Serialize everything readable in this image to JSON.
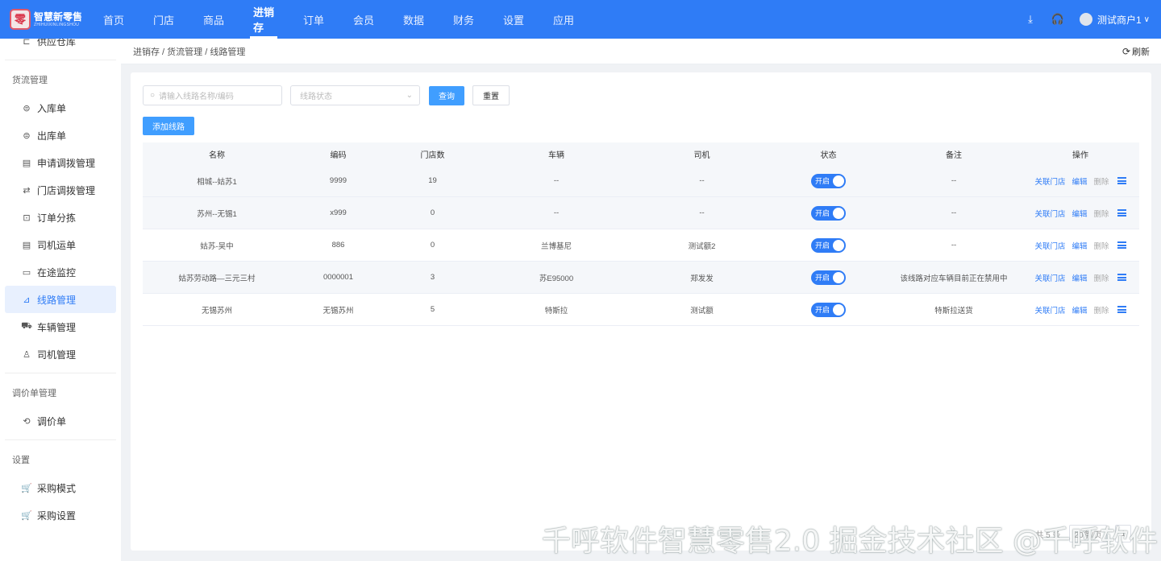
{
  "brand": {
    "name": "智慧新零售",
    "sub": "ZHIHUIXINLINGSHOU",
    "mark": "零"
  },
  "nav": {
    "items": [
      "首页",
      "门店",
      "商品",
      "进销存",
      "订单",
      "会员",
      "数据",
      "财务",
      "设置",
      "应用"
    ],
    "active_index": 3
  },
  "user": {
    "name": "测试商户1"
  },
  "sidebar": {
    "top_item": "供应仓库",
    "group1": "货流管理",
    "items1": [
      "入库单",
      "出库单",
      "申请调拨管理",
      "门店调拨管理",
      "订单分拣",
      "司机运单",
      "在途监控",
      "线路管理",
      "车辆管理",
      "司机管理"
    ],
    "active": "线路管理",
    "group2": "调价单管理",
    "items2": [
      "调价单"
    ],
    "group3": "设置",
    "items3": [
      "采购模式",
      "采购设置"
    ]
  },
  "breadcrumb": "进销存 / 货流管理 / 线路管理",
  "refresh_label": "刷新",
  "filters": {
    "search_placeholder": "请输入线路名称/编码",
    "status_placeholder": "线路状态",
    "query_label": "查询",
    "reset_label": "重置"
  },
  "add_label": "添加线路",
  "table": {
    "headers": [
      "名称",
      "编码",
      "门店数",
      "车辆",
      "司机",
      "状态",
      "备注",
      "操作"
    ],
    "rows": [
      {
        "name": "相城--姑苏1",
        "code": "9999",
        "stores": "19",
        "vehicle": "--",
        "driver": "--",
        "status": "开启",
        "remark": "--"
      },
      {
        "name": "苏州--无锡1",
        "code": "x999",
        "stores": "0",
        "vehicle": "--",
        "driver": "--",
        "status": "开启",
        "remark": "--"
      },
      {
        "name": "姑苏-吴中",
        "code": "886",
        "stores": "0",
        "vehicle": "兰博基尼",
        "driver": "测试额2",
        "status": "开启",
        "remark": "--"
      },
      {
        "name": "姑苏劳动路—三元三村",
        "code": "0000001",
        "stores": "3",
        "vehicle": "苏E95000",
        "driver": "郑发发",
        "status": "开启",
        "remark": "该线路对应车辆目前正在禁用中"
      },
      {
        "name": "无锡苏州",
        "code": "无锡苏州",
        "stores": "5",
        "vehicle": "特斯拉",
        "driver": "测试额",
        "status": "开启",
        "remark": "特斯拉送货"
      }
    ],
    "ops": {
      "link_store": "关联门店",
      "edit": "编辑",
      "delete": "删除"
    }
  },
  "pager": {
    "total": "共 5 条",
    "size": "20条/页",
    "page": "1"
  },
  "watermark": "千呼软件智慧零售2.0 掘金技术社区 @千呼软件"
}
